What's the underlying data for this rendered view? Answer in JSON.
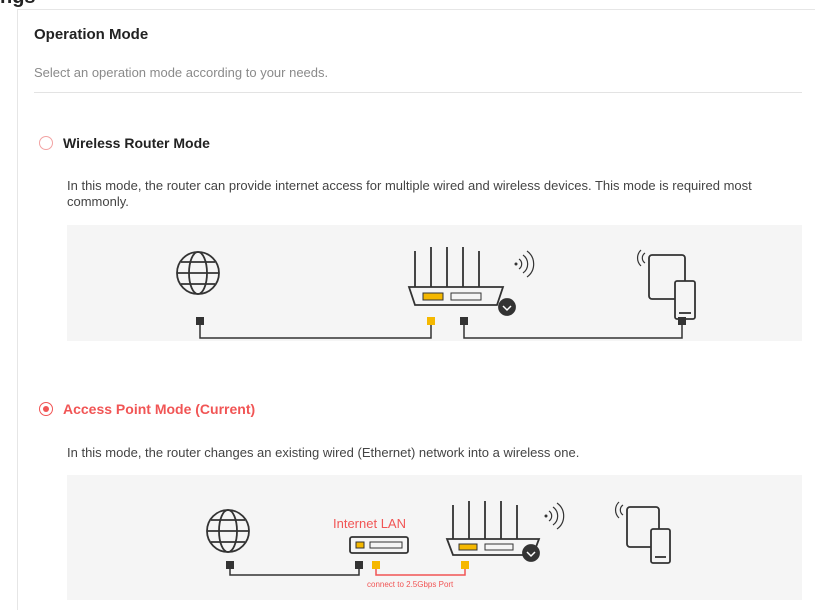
{
  "header_partial": "ngs",
  "section": {
    "title": "Operation Mode",
    "description": "Select an operation mode according to your needs."
  },
  "modes": [
    {
      "label": "Wireless Router Mode",
      "checked": false,
      "description": "In this mode, the router can provide internet access for multiple wired and wireless devices. This mode is required most commonly."
    },
    {
      "label": "Access Point Mode (Current)",
      "checked": true,
      "description": "In this mode, the router changes an existing wired (Ethernet) network into a wireless one.",
      "illus_labels": {
        "internet_lan": "Internet LAN",
        "connect_note": "connect to 2.5Gbps Port"
      }
    }
  ],
  "colors": {
    "accent": "#f15555",
    "port_yellow": "#f5b800",
    "panel_bg": "#f5f5f5"
  }
}
